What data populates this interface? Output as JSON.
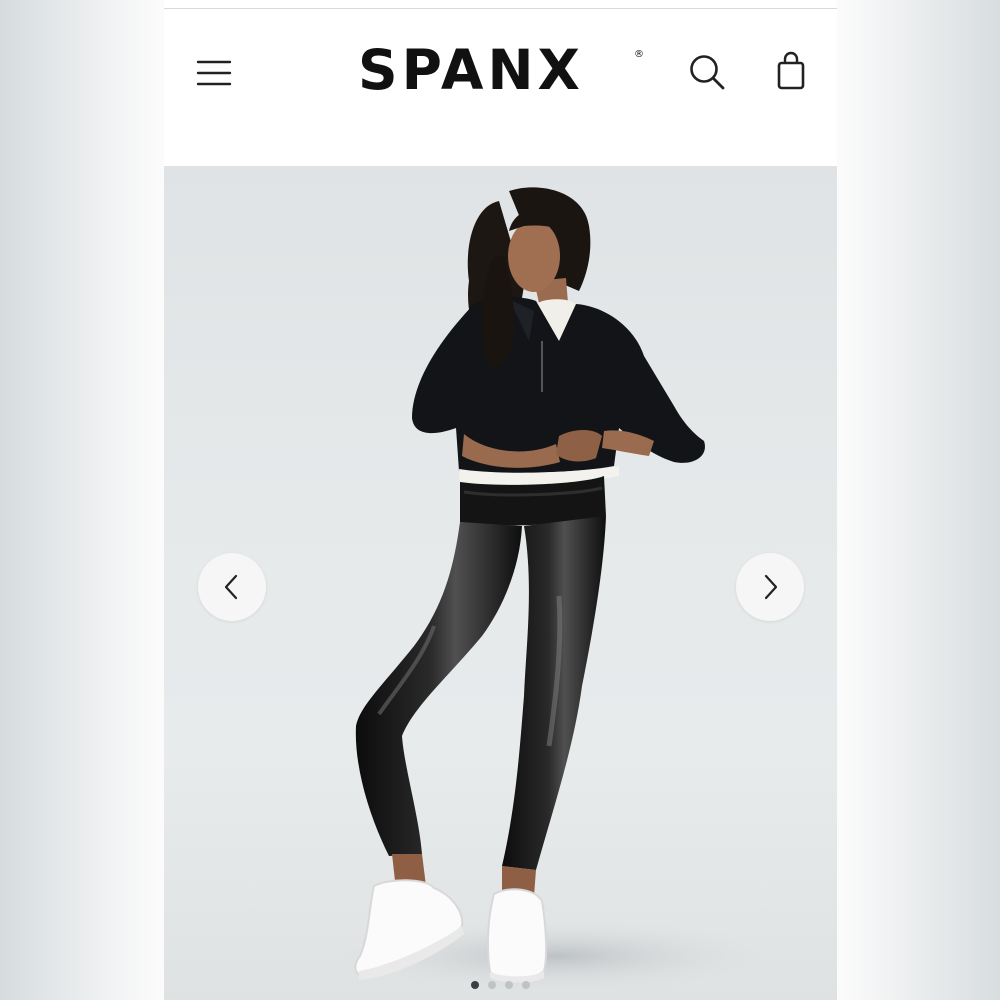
{
  "header": {
    "logo_text": "SPANX",
    "registered_mark": "®",
    "icons": {
      "menu": "hamburger-menu-icon",
      "search": "search-icon",
      "bag": "shopping-bag-icon"
    }
  },
  "carousel": {
    "image": {
      "subject": "product-photo-model-in-faux-leather-leggings"
    },
    "prev_icon": "chevron-left-icon",
    "next_icon": "chevron-right-icon",
    "slide_count": 4,
    "active_slide": 1
  },
  "colors": {
    "brand_text": "#111111",
    "hero_background": "#e5e9ea",
    "active_dot": "#3b3f44",
    "inactive_dot": "#bfc3c6"
  }
}
